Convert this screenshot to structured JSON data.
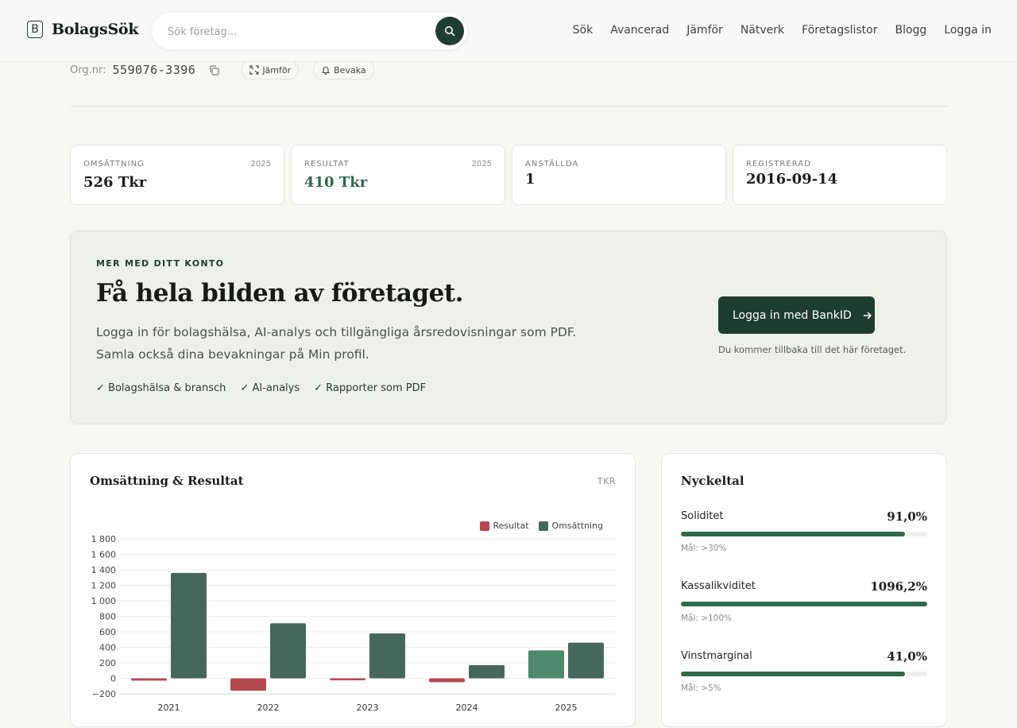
{
  "header": {
    "brand": "BolagsSök",
    "logo_letter": "B",
    "search_placeholder": "Sök företag...",
    "nav": [
      "Sök",
      "Avancerad",
      "Jämför",
      "Nätverk",
      "Företagslistor",
      "Blogg",
      "Logga in"
    ]
  },
  "company": {
    "org_label": "Org.nr:",
    "org_number": "559076-3396",
    "compare_label": "Jämför",
    "watch_label": "Bevaka"
  },
  "stats": [
    {
      "label": "OMSÄTTNING",
      "year": "2025",
      "value": "526 Tkr",
      "color": "#1b1f1d"
    },
    {
      "label": "RESULTAT",
      "year": "2025",
      "value": "410 Tkr",
      "color": "#2e6a4b"
    },
    {
      "label": "ANSTÄLLDA",
      "year": "",
      "value": "1",
      "color": "#1b1f1d"
    },
    {
      "label": "REGISTRERAD",
      "year": "",
      "value": "2016-09-14",
      "color": "#1b1f1d"
    }
  ],
  "promo": {
    "kicker": "MER MED DITT KONTO",
    "headline": "Få hela bilden av företaget.",
    "body": "Logga in för bolagshälsa, AI-analys och tillgängliga årsredovisningar som PDF. Samla också dina bevakningar på Min profil.",
    "features": [
      "✓  Bolagshälsa & bransch",
      "✓  AI-analys",
      "✓  Rapporter som PDF"
    ],
    "cta": "Logga in med BankID",
    "note": "Du kommer tillbaka till det här företaget."
  },
  "chart_section": {
    "title": "Omsättning & Resultat",
    "unit": "TKR"
  },
  "chart_data": {
    "type": "bar",
    "categories": [
      "2021",
      "2022",
      "2023",
      "2024",
      "2025"
    ],
    "series": [
      {
        "name": "Resultat",
        "values": [
          -30,
          -160,
          -10,
          -50,
          360
        ],
        "color": "#b5484f",
        "positive_color": "#4e8a6c"
      },
      {
        "name": "Omsättning",
        "values": [
          1360,
          710,
          580,
          170,
          460
        ],
        "color": "#45685a"
      }
    ],
    "ylim": [
      -200,
      1800
    ],
    "yticks": [
      -200,
      0,
      200,
      400,
      600,
      800,
      1000,
      1200,
      1400,
      1600,
      1800
    ],
    "ytick_labels": [
      "−200",
      "0",
      "200",
      "400",
      "600",
      "800",
      "1 000",
      "1 200",
      "1 400",
      "1 600",
      "1 800"
    ],
    "legend_position": "top-right",
    "grid": true
  },
  "metrics": {
    "title": "Nyckeltal",
    "items": [
      {
        "name": "Soliditet",
        "value": "91,0%",
        "fill": 0.91,
        "goal": "Mål: >30%"
      },
      {
        "name": "Kassalikviditet",
        "value": "1096,2%",
        "fill": 1.0,
        "goal": "Mål: >100%"
      },
      {
        "name": "Vinstmarginal",
        "value": "41,0%",
        "fill": 0.91,
        "goal": "Mål: >5%"
      }
    ]
  }
}
